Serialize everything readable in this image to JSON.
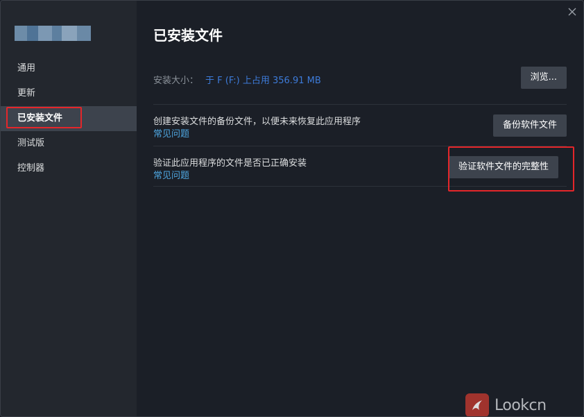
{
  "sidebar": {
    "app_name_blurred": true,
    "items": [
      {
        "label": "通用",
        "active": false
      },
      {
        "label": "更新",
        "active": false
      },
      {
        "label": "已安装文件",
        "active": true
      },
      {
        "label": "测试版",
        "active": false
      },
      {
        "label": "控制器",
        "active": false
      }
    ]
  },
  "main": {
    "title": "已安装文件",
    "install_size": {
      "label": "安装大小：",
      "value": "于 F (F:) 上占用 356.91 MB",
      "button": "浏览..."
    },
    "backup": {
      "text": "创建安装文件的备份文件，以便未来恢复此应用程序",
      "link": "常见问题",
      "button": "备份软件文件"
    },
    "verify": {
      "text": "验证此应用程序的文件是否已正确安装",
      "link": "常见问题",
      "button": "验证软件文件的完整性"
    }
  },
  "watermark": {
    "text": "Lookcn"
  },
  "colors": {
    "sidebar_bg": "#23272e",
    "main_bg": "#1b1f27",
    "active_item_bg": "#3d434d",
    "button_bg": "#3d434d",
    "link": "#4ea6e0",
    "size_value": "#3d7bd9",
    "highlight": "#e5262a"
  }
}
